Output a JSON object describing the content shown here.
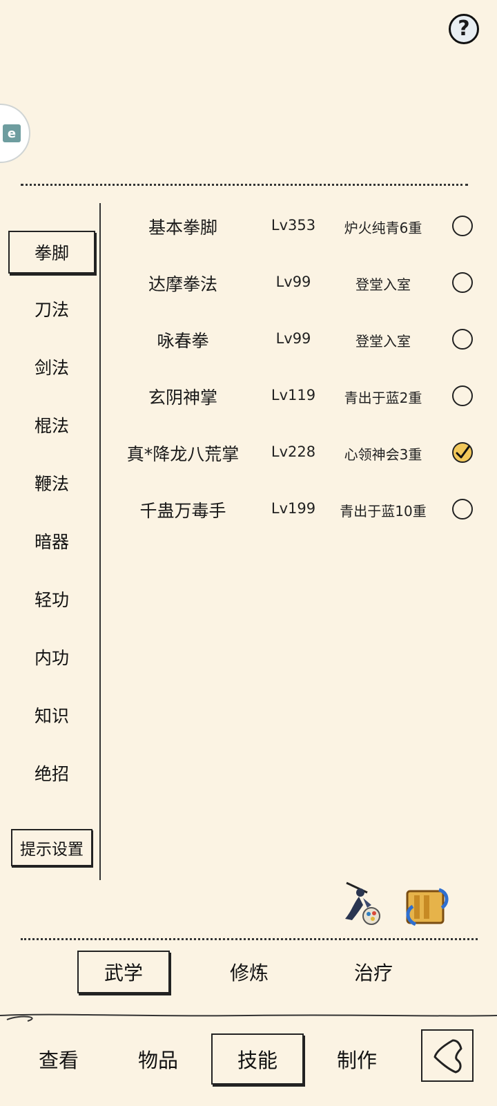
{
  "header": {
    "help_symbol": "?",
    "help_icon": "question-icon",
    "side_avatar_glyph": "e"
  },
  "categories": [
    {
      "label": "拳脚",
      "active": true
    },
    {
      "label": "刀法",
      "active": false
    },
    {
      "label": "剑法",
      "active": false
    },
    {
      "label": "棍法",
      "active": false
    },
    {
      "label": "鞭法",
      "active": false
    },
    {
      "label": "暗器",
      "active": false
    },
    {
      "label": "轻功",
      "active": false
    },
    {
      "label": "内功",
      "active": false
    },
    {
      "label": "知识",
      "active": false
    },
    {
      "label": "绝招",
      "active": false
    }
  ],
  "hint_settings_label": "提示设置",
  "skills": [
    {
      "name": "基本拳脚",
      "level": "Lv353",
      "rank": "炉火纯青6重",
      "checked": false
    },
    {
      "name": "达摩拳法",
      "level": "Lv99",
      "rank": "登堂入室",
      "checked": false
    },
    {
      "name": "咏春拳",
      "level": "Lv99",
      "rank": "登堂入室",
      "checked": false
    },
    {
      "name": "玄阴神掌",
      "level": "Lv119",
      "rank": "青出于蓝2重",
      "checked": false
    },
    {
      "name": "真*降龙八荒掌",
      "level": "Lv228",
      "rank": "心领神会3重",
      "checked": true
    },
    {
      "name": "千蛊万毒手",
      "level": "Lv199",
      "rank": "青出于蓝10重",
      "checked": false
    }
  ],
  "sub_tabs": [
    {
      "label": "武学",
      "active": true
    },
    {
      "label": "修炼",
      "active": false
    },
    {
      "label": "治疗",
      "active": false
    }
  ],
  "nav_tabs": [
    {
      "label": "查看",
      "active": false
    },
    {
      "label": "物品",
      "active": false
    },
    {
      "label": "技能",
      "active": true
    },
    {
      "label": "制作",
      "active": false
    }
  ],
  "colors": {
    "background": "#fbf3e3",
    "checked_fill": "#f2c85a",
    "ink": "#1a1a1a"
  }
}
